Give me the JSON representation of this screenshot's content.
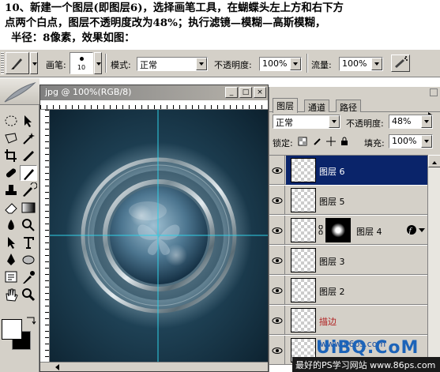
{
  "caption": {
    "line1": "10、新建一个图层(即图层6)，选择画笔工具，在蝴蝶头左上方和右下方",
    "line2": "点两个白点，图层不透明度改为48%；执行滤镜—模糊—高斯模糊，",
    "line3": "半径：8像素，效果如图："
  },
  "options_bar": {
    "brush_label": "画笔:",
    "brush_size": "10",
    "mode_label": "模式:",
    "mode_value": "正常",
    "opacity_label": "不透明度:",
    "opacity_value": "100%",
    "flow_label": "流量:",
    "flow_value": "100%"
  },
  "document": {
    "title": "jpg @ 100%(RGB/8)",
    "btn_min": "_",
    "btn_max": "□",
    "btn_close": "×"
  },
  "layers_panel": {
    "tabs": [
      "图层",
      "通道",
      "路径"
    ],
    "blend_mode": "正常",
    "opacity_label": "不透明度:",
    "opacity_value": "48%",
    "lock_label": "锁定:",
    "fill_label": "填充:",
    "fill_value": "100%",
    "layers": [
      {
        "name": "图层 6",
        "selected": true
      },
      {
        "name": "图层 5",
        "selected": false
      },
      {
        "name": "图层 4",
        "selected": false
      },
      {
        "name": "图层 3",
        "selected": false
      },
      {
        "name": "图层 2",
        "selected": false
      },
      {
        "name": "描边",
        "selected": false
      }
    ]
  },
  "watermark": {
    "url": "www.86ps.com",
    "brand": "UiBQ.CoM",
    "footer": "最好的PS学习网站 www.86ps.com"
  },
  "colors": {
    "selection": "#0a246a",
    "ui_face": "#d4d0c8",
    "canvas_bg": "#1a3344",
    "guide": "#2fd0e6"
  }
}
